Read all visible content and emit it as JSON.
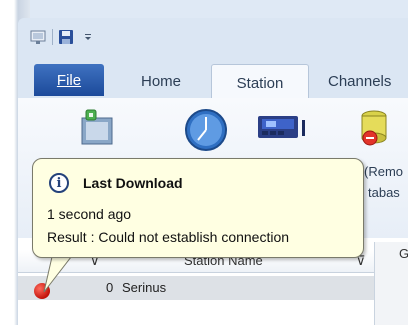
{
  "qat": {
    "items": [
      "app-icon",
      "save-icon",
      "customize-dropdown-icon"
    ]
  },
  "tabs": [
    {
      "label": "File",
      "active": false
    },
    {
      "label": "Home",
      "active": false
    },
    {
      "label": "Station",
      "active": true
    },
    {
      "label": "Channels",
      "active": false
    }
  ],
  "ribbon": {
    "buttons": [
      "station-properties-icon",
      "clock-icon",
      "device-icon",
      "database-remove-icon"
    ],
    "partial_text_1": "(Remo",
    "partial_text_2": "tabas"
  },
  "grid": {
    "headers": {
      "station_name": "Station Name"
    },
    "rows": [
      {
        "count": "0",
        "name": "Serinus",
        "status": "error"
      }
    ],
    "right_panel_label": "G"
  },
  "tooltip": {
    "title": "Last Download",
    "line1": "1 second ago",
    "line2": "Result : Could not establish connection"
  },
  "colors": {
    "file_tab": "#2a5cad",
    "tooltip_bg": "#ffffe2",
    "status_error": "#d01a10"
  }
}
